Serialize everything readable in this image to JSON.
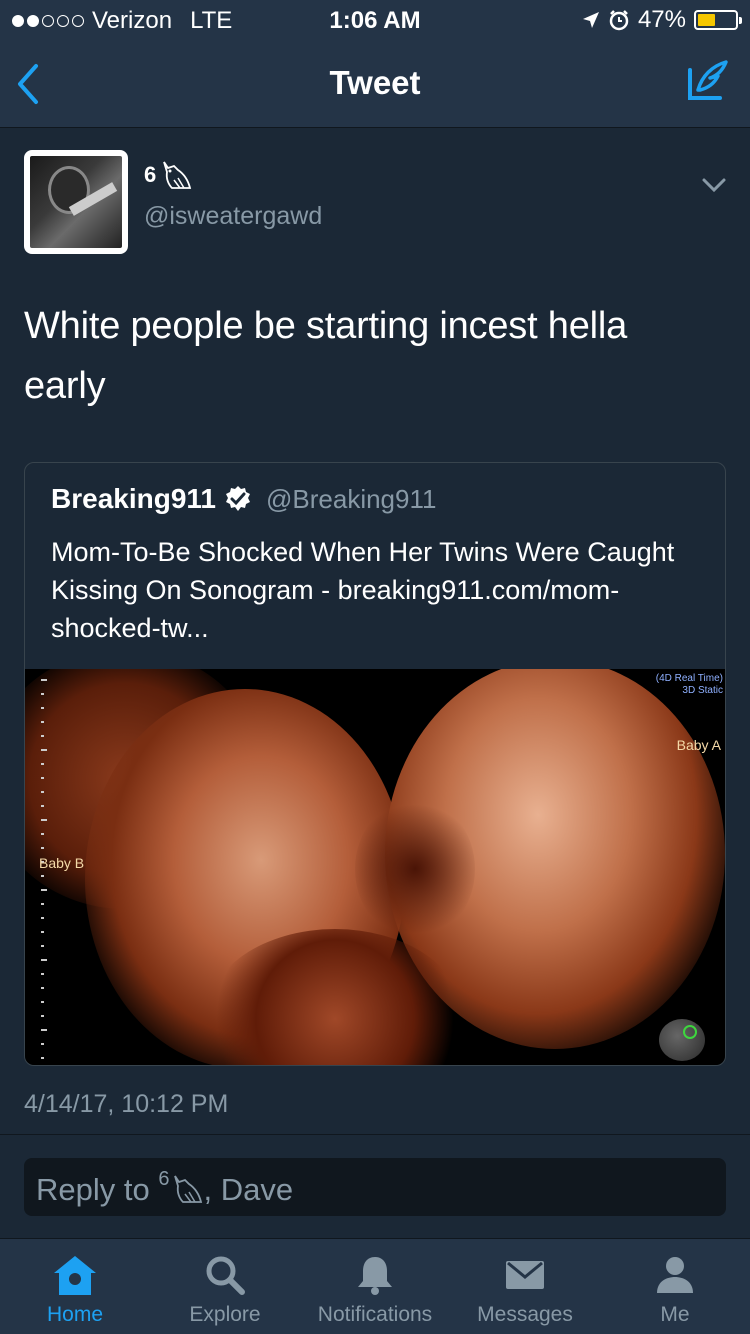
{
  "status_bar": {
    "carrier": "Verizon",
    "network": "LTE",
    "time": "1:06 AM",
    "battery": "47%",
    "battery_level": 0.47,
    "signal_bars": 2
  },
  "nav": {
    "title": "Tweet",
    "back_icon": "chevron-left-icon",
    "compose_icon": "compose-icon"
  },
  "tweet": {
    "display_name": "6",
    "handle": "@isweatergawd",
    "text": "White people be starting incest hella early",
    "timestamp": "4/14/17, 10:12 PM"
  },
  "quote": {
    "name": "Breaking911",
    "handle": "@Breaking911",
    "verified": true,
    "text": "Mom-To-Be Shocked When Her Twins Were Caught Kissing On Sonogram - breaking911.com/mom-shocked-tw...",
    "image_labels": {
      "baby_a": "Baby A",
      "baby_b": "Baby B",
      "mode_1": "(4D Real Time)",
      "mode_2": "3D Static"
    }
  },
  "reply": {
    "prefix": "Reply to ",
    "name_1": "6",
    "suffix": ", Dave"
  },
  "tabs": [
    {
      "label": "Home",
      "icon": "home-icon",
      "active": true
    },
    {
      "label": "Explore",
      "icon": "search-icon",
      "active": false
    },
    {
      "label": "Notifications",
      "icon": "bell-icon",
      "active": false
    },
    {
      "label": "Messages",
      "icon": "envelope-icon",
      "active": false
    },
    {
      "label": "Me",
      "icon": "person-icon",
      "active": false
    }
  ],
  "colors": {
    "background": "#1b2836",
    "bar": "#243447",
    "accent": "#1da1f2",
    "secondary_text": "#8899a6"
  }
}
